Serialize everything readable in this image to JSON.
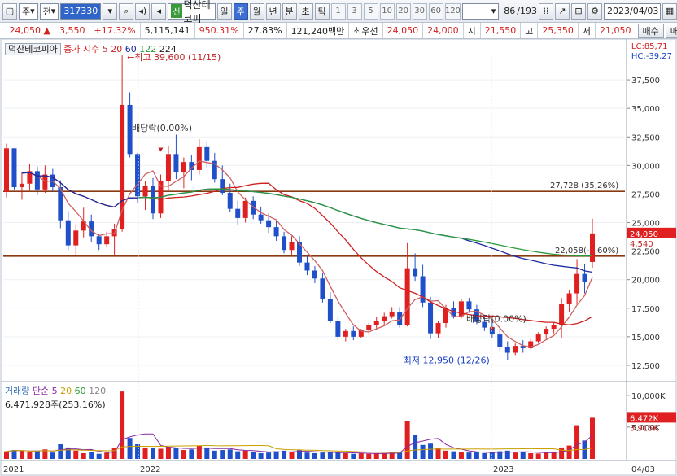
{
  "toolbar": {
    "market": "주",
    "type": "전",
    "code": "317330",
    "stock_name": "덕산테코피",
    "stock_badge": "신",
    "periods": [
      "일",
      "주",
      "월",
      "년",
      "분",
      "초",
      "틱"
    ],
    "active_period": "주",
    "intervals": [
      "1",
      "3",
      "5",
      "10",
      "20",
      "30",
      "60",
      "120"
    ],
    "count": "86",
    "total": "/193",
    "date": "2023/04/03"
  },
  "info": {
    "price": "24,050",
    "change": "3,550",
    "change_pct": "+17.32%",
    "volume": "5,115,141",
    "volume_ratio": "950.31%",
    "turnover": "27.83%",
    "amount": "121,240백만",
    "best_ask_label": "최우선",
    "best_ask": "24,050",
    "best_bid": "24,000",
    "open_label": "시",
    "open": "21,550",
    "high_label": "고",
    "high": "25,350",
    "low_label": "저",
    "low": "21,050",
    "buy_button": "매수",
    "sell_button": "매도"
  },
  "chart_legend": {
    "stock": "덕산테코피아",
    "indicator": "종가 지수",
    "ma5": "5",
    "ma20": "20",
    "ma60": "60",
    "ma122": "122",
    "ma224": "224",
    "lc": "LC:85,71",
    "hc": "HC:-39,27"
  },
  "annotations": {
    "high": "←최고 39,600 (11/15)",
    "low": "최저 12,950 (12/26)",
    "dividend1": "배당락(0.00%)",
    "dividend2": "배당락(0.00%)",
    "line1": "27,728 (35,26%)",
    "line2": "22,058(-7,60%)"
  },
  "volume_legend": {
    "title": "거래량",
    "kind": "단순",
    "ma5": "5",
    "ma20": "20",
    "ma60": "60",
    "ma120": "120",
    "value": "6,471,928주(253,16%)"
  },
  "axis": {
    "price_ticks": [
      "37,500",
      "35,000",
      "32,500",
      "30,000",
      "27,500",
      "25,000",
      "22,500",
      "20,000",
      "17,500",
      "15,000",
      "12,500"
    ],
    "current_price": "24,050",
    "price_marker2": "4,540",
    "volume_ticks": [
      "10,000K",
      "5,000K"
    ],
    "volume_current": "6,472K",
    "volume_marker2": "3,915K",
    "x_labels": [
      "2021",
      "2022",
      "2023",
      "04/03"
    ]
  },
  "colors": {
    "up": "#e02020",
    "down": "#1f4fc9",
    "ma5": "#c04040",
    "ma20": "#d02020",
    "ma60": "#1a2aa0",
    "ma122": "#2a9a3a",
    "hline": "#8a3a10"
  },
  "chart_data": {
    "type": "candlestick",
    "title": "덕산테코피아",
    "price_range": [
      11500,
      39500
    ],
    "hlines": [
      27728,
      22058
    ],
    "candles": [
      [
        27700,
        31900,
        27200,
        31500
      ],
      [
        31500,
        30600,
        27900,
        28100
      ],
      [
        28100,
        29400,
        27000,
        28400
      ],
      [
        28400,
        30100,
        27800,
        29500
      ],
      [
        29500,
        29900,
        27400,
        27900
      ],
      [
        27900,
        30000,
        27600,
        29200
      ],
      [
        29200,
        29700,
        27700,
        28100
      ],
      [
        28100,
        28700,
        24500,
        25200
      ],
      [
        25200,
        26000,
        22600,
        23000
      ],
      [
        23000,
        24800,
        22200,
        24300
      ],
      [
        24300,
        26300,
        23700,
        25100
      ],
      [
        25100,
        25700,
        23300,
        23800
      ],
      [
        23800,
        24000,
        22600,
        23100
      ],
      [
        23100,
        24200,
        22900,
        23800
      ],
      [
        23800,
        24900,
        22100,
        24400
      ],
      [
        24400,
        39600,
        24200,
        35300
      ],
      [
        35300,
        36400,
        30700,
        31000
      ],
      [
        31000,
        31100,
        26700,
        27300
      ],
      [
        27300,
        28600,
        26100,
        28200
      ],
      [
        28200,
        28900,
        25300,
        25800
      ],
      [
        25800,
        29200,
        25400,
        28600
      ],
      [
        28600,
        31700,
        27800,
        31000
      ],
      [
        31000,
        32700,
        28800,
        29400
      ],
      [
        29400,
        30700,
        28000,
        30300
      ],
      [
        30300,
        30900,
        28700,
        29600
      ],
      [
        29600,
        32300,
        29200,
        31600
      ],
      [
        31600,
        32100,
        29800,
        30400
      ],
      [
        30400,
        31100,
        28500,
        28800
      ],
      [
        28800,
        30000,
        27400,
        27600
      ],
      [
        27600,
        28400,
        25900,
        26200
      ],
      [
        26200,
        26900,
        24800,
        25400
      ],
      [
        25400,
        27200,
        25000,
        26900
      ],
      [
        26900,
        27300,
        25300,
        25700
      ],
      [
        25700,
        26400,
        24900,
        25200
      ],
      [
        25200,
        25800,
        24100,
        24600
      ],
      [
        24600,
        25100,
        23400,
        23800
      ],
      [
        23800,
        24200,
        22300,
        22600
      ],
      [
        22600,
        23800,
        22200,
        23300
      ],
      [
        23300,
        23800,
        21200,
        21500
      ],
      [
        21500,
        22100,
        20400,
        20800
      ],
      [
        20800,
        21200,
        19700,
        20100
      ],
      [
        20100,
        20600,
        18000,
        18300
      ],
      [
        18300,
        18900,
        16200,
        16400
      ],
      [
        16400,
        16800,
        14700,
        15000
      ],
      [
        15000,
        15700,
        14600,
        15500
      ],
      [
        15500,
        15900,
        14700,
        15000
      ],
      [
        15000,
        15700,
        14900,
        15600
      ],
      [
        15600,
        16200,
        15300,
        16000
      ],
      [
        16000,
        16700,
        15600,
        16400
      ],
      [
        16400,
        17100,
        16000,
        16800
      ],
      [
        16800,
        17600,
        16600,
        17200
      ],
      [
        17200,
        17600,
        15800,
        16000
      ],
      [
        16000,
        23200,
        15900,
        21000
      ],
      [
        21000,
        22300,
        19900,
        20300
      ],
      [
        20300,
        21300,
        17600,
        18000
      ],
      [
        18000,
        18500,
        14800,
        15300
      ],
      [
        15300,
        16400,
        14900,
        16200
      ],
      [
        16200,
        17800,
        15800,
        17500
      ],
      [
        17500,
        18100,
        16600,
        16800
      ],
      [
        16800,
        18300,
        16600,
        18100
      ],
      [
        18100,
        18400,
        17100,
        17400
      ],
      [
        17400,
        17800,
        16100,
        16300
      ],
      [
        16300,
        16900,
        15500,
        15800
      ],
      [
        15800,
        16400,
        14900,
        15200
      ],
      [
        15200,
        15700,
        13800,
        14100
      ],
      [
        14100,
        14600,
        12950,
        13600
      ],
      [
        13600,
        14400,
        13400,
        14200
      ],
      [
        14200,
        14700,
        13600,
        14000
      ],
      [
        14000,
        14800,
        13900,
        14600
      ],
      [
        14600,
        15400,
        14400,
        15200
      ],
      [
        15200,
        15900,
        14800,
        15700
      ],
      [
        15700,
        16300,
        15300,
        16000
      ],
      [
        16000,
        18400,
        14900,
        17900
      ],
      [
        17900,
        19100,
        17200,
        18800
      ],
      [
        18800,
        21800,
        17900,
        20500
      ],
      [
        20500,
        21400,
        18800,
        19800
      ],
      [
        21550,
        25350,
        21050,
        24050
      ]
    ],
    "volume_k": [
      1200,
      1400,
      1300,
      1100,
      1250,
      1500,
      1000,
      2300,
      1800,
      1300,
      900,
      1100,
      800,
      950,
      1700,
      10600,
      3300,
      2300,
      1800,
      1700,
      1600,
      1900,
      1700,
      1400,
      1500,
      2100,
      1800,
      1300,
      1400,
      1500,
      1200,
      1300,
      1100,
      900,
      1000,
      1200,
      1300,
      1100,
      1400,
      1000,
      900,
      1000,
      1100,
      1000,
      900,
      800,
      900,
      800,
      850,
      900,
      1000,
      1100,
      6000,
      3800,
      2200,
      2400,
      1700,
      1300,
      1200,
      1100,
      1000,
      1050,
      900,
      1000,
      1200,
      1300,
      1000,
      1100,
      900,
      850,
      1000,
      1100,
      1800,
      2100,
      5300,
      2900,
      6472
    ],
    "x_labels": [
      "2021",
      "2022",
      "2023",
      "04/03"
    ]
  }
}
